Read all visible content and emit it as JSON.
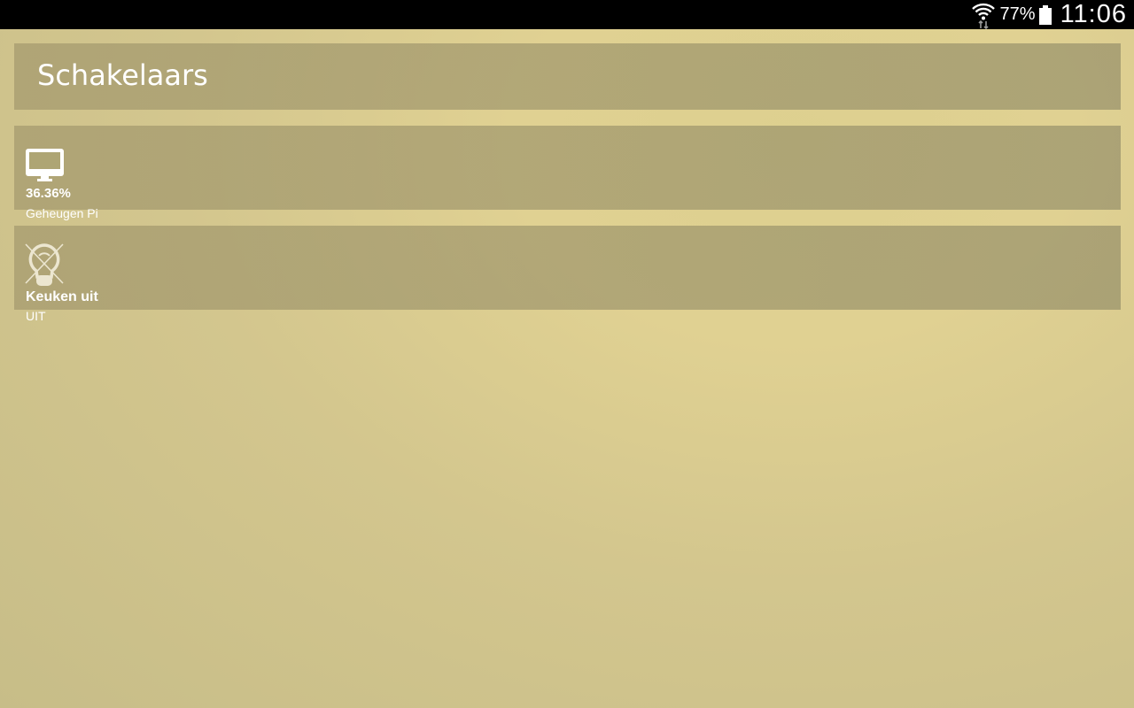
{
  "status_bar": {
    "battery_percent": "77%",
    "time": "11:06",
    "wifi_icon": "wifi-icon",
    "battery_icon": "battery-icon"
  },
  "header": {
    "title": "Schakelaars"
  },
  "items": [
    {
      "icon": "monitor-icon",
      "value": "36.36%",
      "label": "Geheugen Pi"
    },
    {
      "icon": "lightbulb-off-icon",
      "value": "Keuken uit",
      "label": "UIT"
    }
  ]
}
